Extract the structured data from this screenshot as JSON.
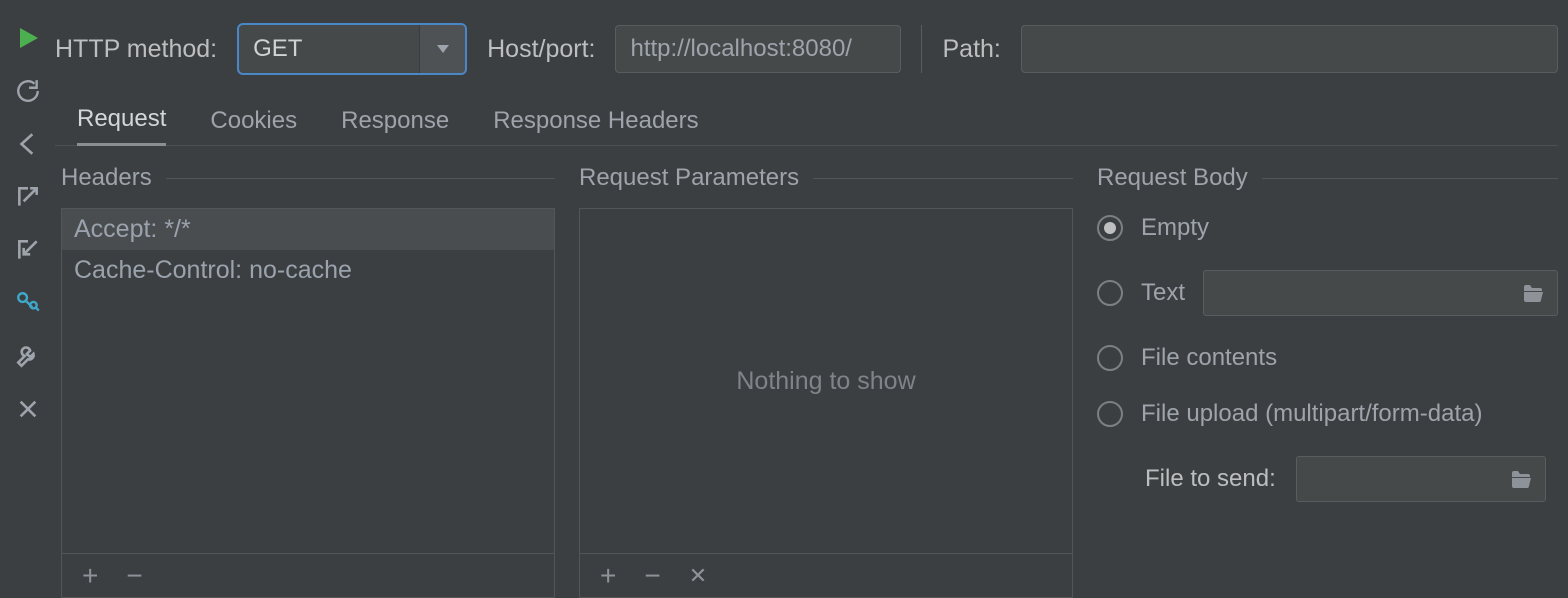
{
  "sidebar": {
    "icons": [
      "run",
      "refresh",
      "back",
      "export",
      "import",
      "keys",
      "wrench",
      "close"
    ]
  },
  "top": {
    "method_label": "HTTP method:",
    "method_value": "GET",
    "host_label": "Host/port:",
    "host_value": "http://localhost:8080/",
    "path_label": "Path:",
    "path_value": ""
  },
  "tabs": {
    "items": [
      "Request",
      "Cookies",
      "Response",
      "Response Headers"
    ],
    "active_index": 0
  },
  "headers_panel": {
    "title": "Headers",
    "rows": [
      "Accept: */*",
      "Cache-Control: no-cache"
    ],
    "selected_index": 0
  },
  "params_panel": {
    "title": "Request Parameters",
    "empty_text": "Nothing to show"
  },
  "body_panel": {
    "title": "Request Body",
    "options": {
      "empty": "Empty",
      "text": "Text",
      "file_contents": "File contents",
      "file_upload": "File upload (multipart/form-data)"
    },
    "selected": "empty",
    "text_value": "",
    "file_label": "File to send:",
    "file_value": ""
  }
}
